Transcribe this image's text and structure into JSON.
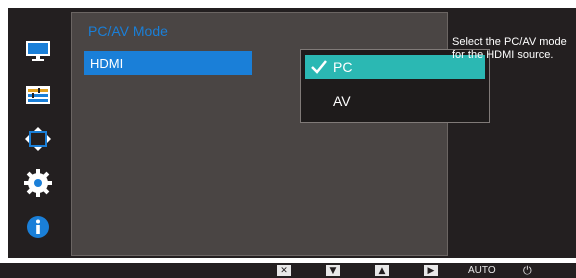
{
  "osd": {
    "title": "PC/AV Mode",
    "menu_item": "HDMI",
    "options": [
      {
        "label": "PC",
        "selected": true
      },
      {
        "label": "AV",
        "selected": false
      }
    ],
    "help_text": "Select the PC/AV mode for the HDMI source."
  },
  "sidebar": {
    "icons": [
      "monitor-icon",
      "color-settings-icon",
      "screen-size-icon",
      "gear-icon",
      "info-icon"
    ]
  },
  "keybar": {
    "close_glyph": "✕",
    "down_glyph": "▼",
    "up_glyph": "▲",
    "enter_glyph": "▶",
    "auto_label": "AUTO",
    "power_glyph": "⏻"
  },
  "colors": {
    "accent": "#1a7fd8",
    "selected": "#2bb8b3",
    "panel": "#4a4544",
    "frame": "#231f20"
  }
}
